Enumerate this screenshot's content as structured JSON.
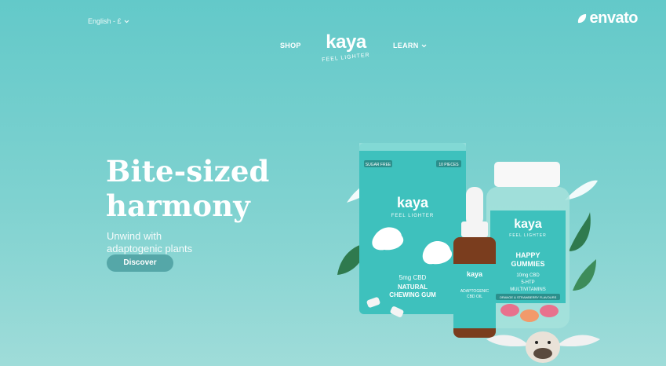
{
  "header": {
    "language_currency": "English - £",
    "nav": {
      "shop": "SHOP",
      "learn": "LEARN"
    },
    "logo": {
      "wordmark": "kaya",
      "tagline": "FEEL LIGHTER"
    },
    "watermark": "envato"
  },
  "hero": {
    "headline_line1": "Bite-sized",
    "headline_line2": "harmony",
    "subtitle_line1": "Unwind with",
    "subtitle_line2": "adaptogenic plants",
    "cta_label": "Discover"
  },
  "products": {
    "pack": {
      "brand": "kaya",
      "tag": "FEEL LIGHTER",
      "badge_left": "SUGAR FREE",
      "badge_right": "10 PIECES",
      "dose": "5mg CBD",
      "name_line1": "NATURAL",
      "name_line2": "CHEWING GUM"
    },
    "bottle": {
      "brand": "kaya",
      "name_line1": "ADAPTOGENIC",
      "name_line2": "CBD OIL"
    },
    "jar": {
      "brand": "kaya",
      "tag": "FEEL LIGHTER",
      "name_line1": "HAPPY",
      "name_line2": "GUMMIES",
      "dose": "10mg CBD",
      "extra_line1": "5-HTP",
      "extra_line2": "MULTIVITAMINS",
      "flavour": "ORANGE & STRAWBERRY FLAVOURS"
    }
  },
  "colors": {
    "background": "#6fcdcb",
    "button": "#55a7a8",
    "product_teal": "#3ec1bd",
    "jar_lid": "#ffffff"
  },
  "icons": [
    "chevron-down-icon",
    "envato-leaf-icon",
    "feather-icon",
    "dog-image"
  ]
}
